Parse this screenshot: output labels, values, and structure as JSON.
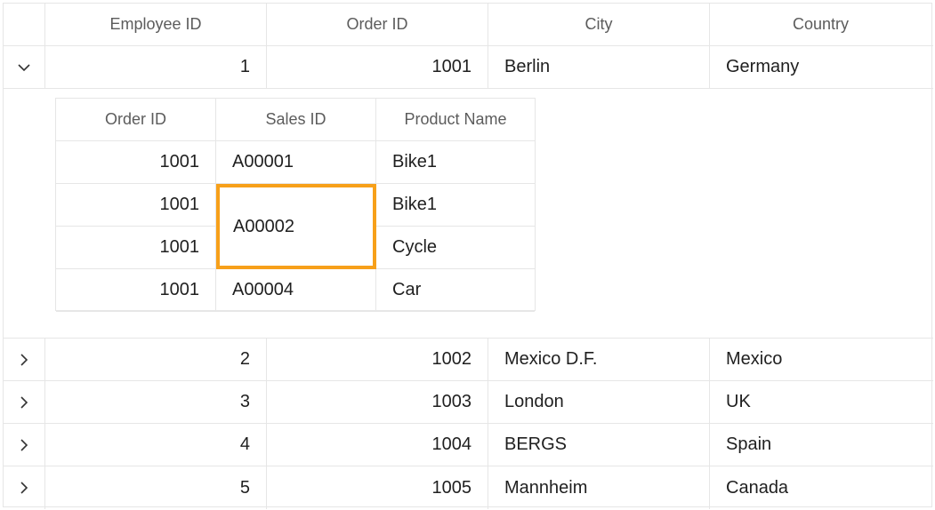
{
  "columns": {
    "employee_id": "Employee ID",
    "order_id": "Order ID",
    "city": "City",
    "country": "Country"
  },
  "rows": [
    {
      "employee_id": "1",
      "order_id": "1001",
      "city": "Berlin",
      "country": "Germany",
      "expanded": true
    },
    {
      "employee_id": "2",
      "order_id": "1002",
      "city": "Mexico D.F.",
      "country": "Mexico",
      "expanded": false
    },
    {
      "employee_id": "3",
      "order_id": "1003",
      "city": "London",
      "country": "UK",
      "expanded": false
    },
    {
      "employee_id": "4",
      "order_id": "1004",
      "city": "BERGS",
      "country": "Spain",
      "expanded": false
    },
    {
      "employee_id": "5",
      "order_id": "1005",
      "city": "Mannheim",
      "country": "Canada",
      "expanded": false
    }
  ],
  "detail": {
    "columns": {
      "order_id": "Order ID",
      "sales_id": "Sales ID",
      "product_name": "Product Name"
    },
    "rows": [
      {
        "order_id": "1001",
        "sales_id": "A00001",
        "product_name": "Bike1"
      },
      {
        "order_id": "1001",
        "sales_id": "A00002",
        "product_name": "Bike1"
      },
      {
        "order_id": "1001",
        "sales_id": "A00002",
        "product_name": "Cycle"
      },
      {
        "order_id": "1001",
        "sales_id": "A00004",
        "product_name": "Car"
      }
    ],
    "merged_sales_id": "A00002"
  },
  "colors": {
    "selection_border": "#f7a01a",
    "grid_line": "#e6e6e6",
    "header_text": "#5c5c5c"
  },
  "icons": {
    "expanded": "chevron-down-icon",
    "collapsed": "chevron-right-icon"
  }
}
